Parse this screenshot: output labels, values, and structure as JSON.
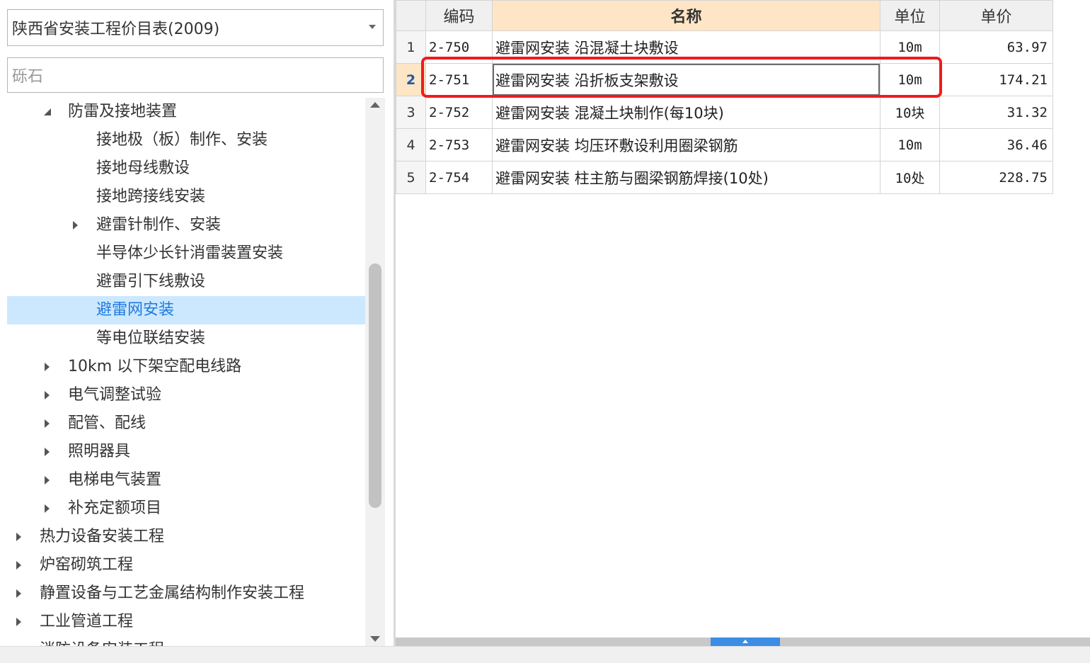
{
  "catalog": {
    "selected": "陕西省安装工程价目表(2009)"
  },
  "search": {
    "value": "砾石"
  },
  "tree": [
    {
      "label": "防雷及接地装置",
      "level": 1,
      "toggle": "expanded",
      "selected": false
    },
    {
      "label": "接地极（板）制作、安装",
      "level": 2,
      "toggle": "none",
      "selected": false
    },
    {
      "label": "接地母线敷设",
      "level": 2,
      "toggle": "none",
      "selected": false
    },
    {
      "label": "接地跨接线安装",
      "level": 2,
      "toggle": "none",
      "selected": false
    },
    {
      "label": "避雷针制作、安装",
      "level": 2,
      "toggle": "collapsed",
      "selected": false
    },
    {
      "label": "半导体少长针消雷装置安装",
      "level": 2,
      "toggle": "none",
      "selected": false
    },
    {
      "label": "避雷引下线敷设",
      "level": 2,
      "toggle": "none",
      "selected": false
    },
    {
      "label": "避雷网安装",
      "level": 2,
      "toggle": "none",
      "selected": true
    },
    {
      "label": "等电位联结安装",
      "level": 2,
      "toggle": "none",
      "selected": false
    },
    {
      "label": "10km 以下架空配电线路",
      "level": 1,
      "toggle": "collapsed",
      "selected": false
    },
    {
      "label": "电气调整试验",
      "level": 1,
      "toggle": "collapsed",
      "selected": false
    },
    {
      "label": "配管、配线",
      "level": 1,
      "toggle": "collapsed",
      "selected": false
    },
    {
      "label": "照明器具",
      "level": 1,
      "toggle": "collapsed",
      "selected": false
    },
    {
      "label": "电梯电气装置",
      "level": 1,
      "toggle": "collapsed",
      "selected": false
    },
    {
      "label": "补充定额项目",
      "level": 1,
      "toggle": "collapsed",
      "selected": false
    },
    {
      "label": "热力设备安装工程",
      "level": 0,
      "toggle": "collapsed",
      "selected": false
    },
    {
      "label": "炉窑砌筑工程",
      "level": 0,
      "toggle": "collapsed",
      "selected": false
    },
    {
      "label": "静置设备与工艺金属结构制作安装工程",
      "level": 0,
      "toggle": "collapsed",
      "selected": false
    },
    {
      "label": "工业管道工程",
      "level": 0,
      "toggle": "collapsed",
      "selected": false
    },
    {
      "label": "消防设备安装工程",
      "level": 0,
      "toggle": "collapsed",
      "selected": false
    }
  ],
  "grid": {
    "columns": {
      "code": "编码",
      "name": "名称",
      "unit": "单位",
      "price": "单价"
    },
    "current_row": 2,
    "rows": [
      {
        "num": "1",
        "code": "2-750",
        "name": "避雷网安装 沿混凝土块敷设",
        "unit": "10m",
        "price": "63.97"
      },
      {
        "num": "2",
        "code": "2-751",
        "name": "避雷网安装 沿折板支架敷设",
        "unit": "10m",
        "price": "174.21"
      },
      {
        "num": "3",
        "code": "2-752",
        "name": "避雷网安装 混凝土块制作(每10块)",
        "unit": "10块",
        "price": "31.32"
      },
      {
        "num": "4",
        "code": "2-753",
        "name": "避雷网安装 均压环敷设利用圈梁钢筋",
        "unit": "10m",
        "price": "36.46"
      },
      {
        "num": "5",
        "code": "2-754",
        "name": "避雷网安装 柱主筋与圈梁钢筋焊接(10处)",
        "unit": "10处",
        "price": "228.75"
      }
    ]
  },
  "colors": {
    "highlight": "#ee1c1c",
    "selection": "#cce8ff",
    "selection_text": "#1e7ae0",
    "header_accent": "#fde5c5",
    "scroll_thumb": "#3c8de4"
  }
}
